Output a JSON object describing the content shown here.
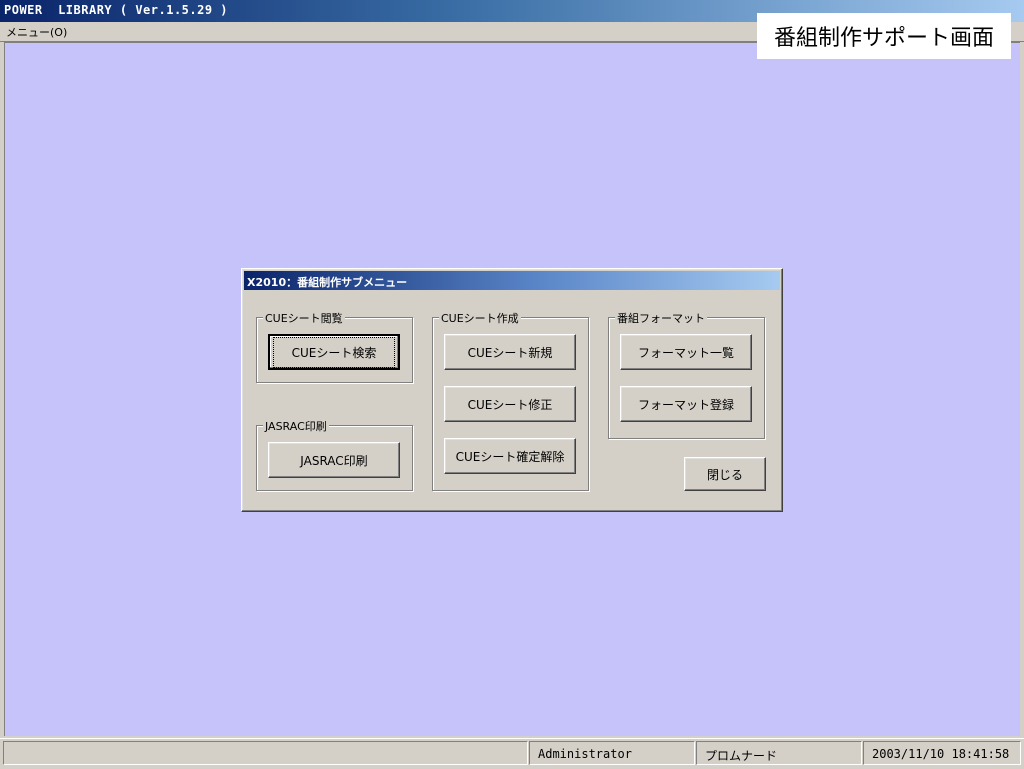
{
  "window": {
    "title": "POWER  LIBRARY ( Ver.1.5.29 )"
  },
  "menubar": {
    "items": [
      {
        "label": "メニュー(O)"
      }
    ]
  },
  "screen_label": "番組制作サポート画面",
  "dialog": {
    "title": "X2010：番組制作サブメニュー",
    "groups": {
      "cue_view": {
        "label": "CUEシート閲覧",
        "buttons": {
          "search": "CUEシート検索"
        }
      },
      "jasrac": {
        "label": "JASRAC印刷",
        "buttons": {
          "print": "JASRAC印刷"
        }
      },
      "cue_create": {
        "label": "CUEシート作成",
        "buttons": {
          "new": "CUEシート新規",
          "edit": "CUEシート修正",
          "unlock": "CUEシート確定解除"
        }
      },
      "format": {
        "label": "番組フォーマット",
        "buttons": {
          "list": "フォーマット一覧",
          "register": "フォーマット登録"
        }
      }
    },
    "close_label": "閉じる"
  },
  "statusbar": {
    "panels": [
      "",
      "Administrator",
      "プロムナード",
      "2003/11/10 18:41:58"
    ]
  },
  "colors": {
    "desktop_bg": "#c6c3fb",
    "titlebar": "#0a246a",
    "chrome": "#d4d0c8"
  }
}
